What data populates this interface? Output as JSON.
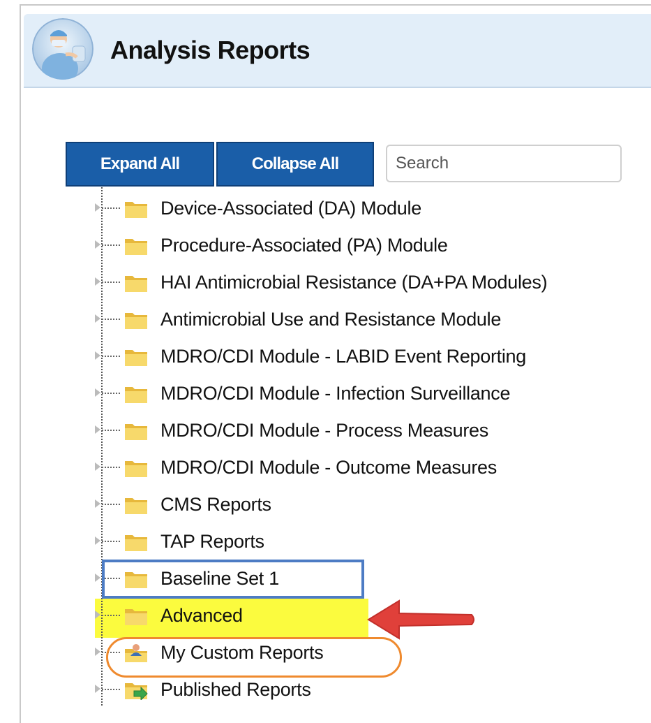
{
  "header": {
    "title": "Analysis Reports",
    "avatar_icon": "surgeon-avatar-icon"
  },
  "toolbar": {
    "expand_label": "Expand All",
    "collapse_label": "Collapse All",
    "search_placeholder": "Search",
    "search_value": ""
  },
  "tree": {
    "items": [
      {
        "label": "Device-Associated (DA) Module",
        "icon": "folder-icon"
      },
      {
        "label": "Procedure-Associated (PA) Module",
        "icon": "folder-icon"
      },
      {
        "label": "HAI Antimicrobial Resistance (DA+PA Modules)",
        "icon": "folder-icon"
      },
      {
        "label": "Antimicrobial Use and Resistance Module",
        "icon": "folder-icon"
      },
      {
        "label": "MDRO/CDI Module - LABID Event Reporting",
        "icon": "folder-icon"
      },
      {
        "label": "MDRO/CDI Module - Infection Surveillance",
        "icon": "folder-icon"
      },
      {
        "label": "MDRO/CDI Module - Process Measures",
        "icon": "folder-icon"
      },
      {
        "label": "MDRO/CDI Module - Outcome Measures",
        "icon": "folder-icon"
      },
      {
        "label": "CMS Reports",
        "icon": "folder-icon"
      },
      {
        "label": "TAP Reports",
        "icon": "folder-icon"
      },
      {
        "label": "Baseline Set 1",
        "icon": "folder-icon"
      },
      {
        "label": "Advanced",
        "icon": "folder-icon"
      },
      {
        "label": "My Custom Reports",
        "icon": "user-folder-icon"
      },
      {
        "label": "Published Reports",
        "icon": "published-folder-icon"
      }
    ]
  },
  "annotations": {
    "blue_box_color": "#4d7cc4",
    "yellow_highlight_color": "#fbfb3e",
    "orange_oval_color": "#ef8a2e",
    "red_arrow_color": "#e0403a"
  }
}
